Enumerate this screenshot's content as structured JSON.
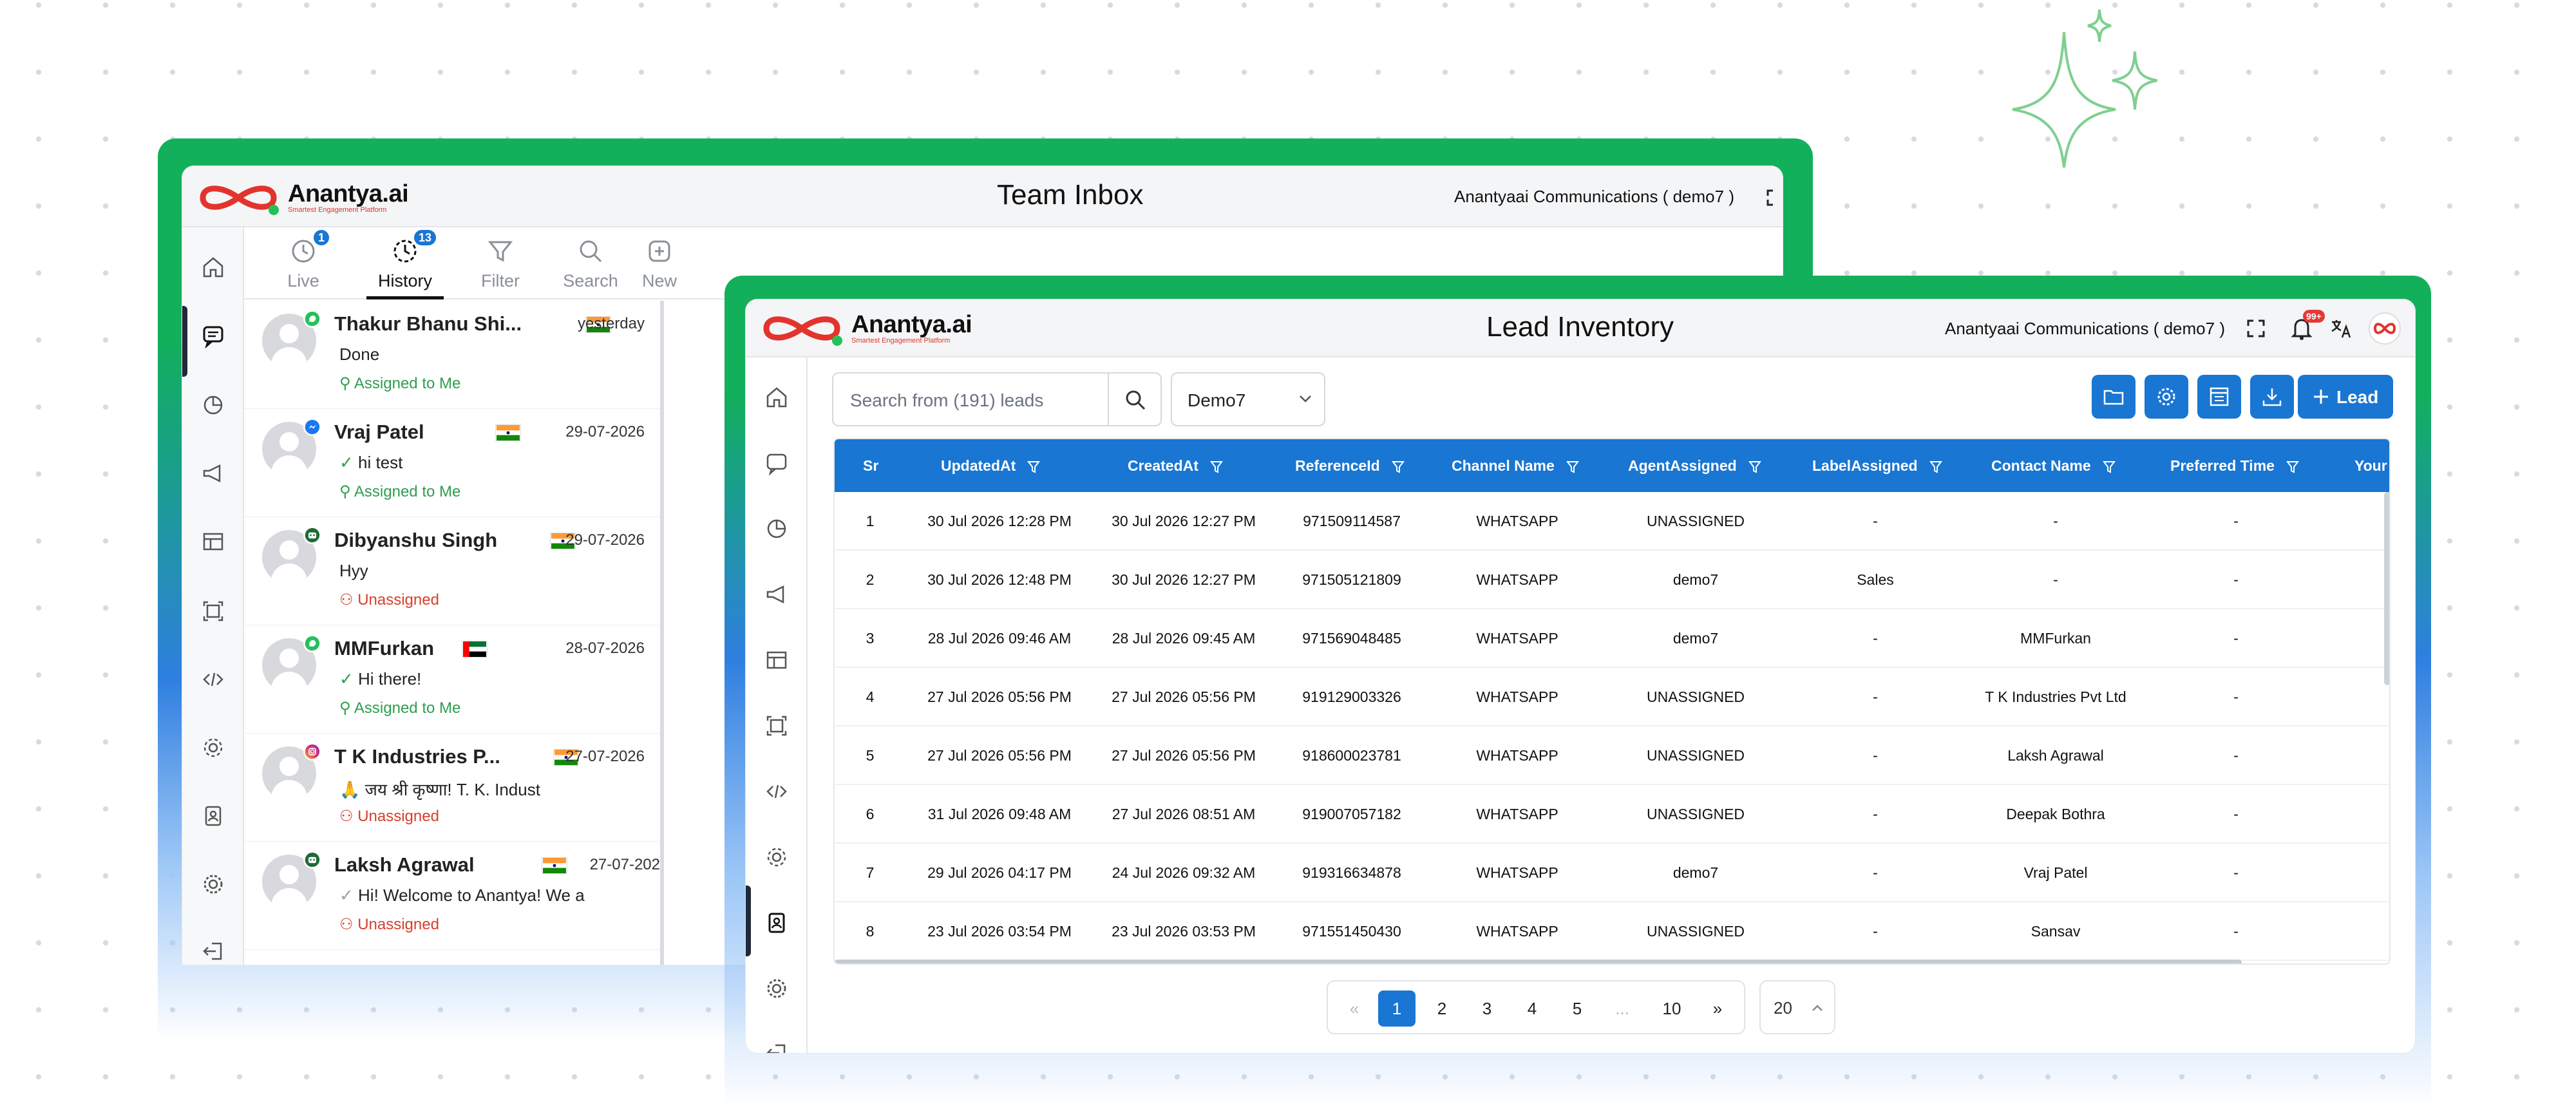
{
  "brand": {
    "name": "Anantya.ai",
    "tagline": "Smartest Engagement Platform"
  },
  "inbox": {
    "title": "Team Inbox",
    "company": "Anantyaai Communications ( demo7 )",
    "tabs": [
      {
        "label": "Live",
        "badge": "1",
        "icon": "clock-icon"
      },
      {
        "label": "History",
        "badge": "13",
        "icon": "history-icon"
      },
      {
        "label": "Filter",
        "icon": "filter-icon"
      },
      {
        "label": "Search",
        "icon": "search-icon"
      },
      {
        "label": "New",
        "icon": "new-chat-icon"
      }
    ],
    "chats": [
      {
        "name": "Thakur Bhanu Shi...",
        "date": "yesterday",
        "message": "Done",
        "status": "Assigned to Me",
        "assigned": true,
        "channel": "whatsapp",
        "flag": "india"
      },
      {
        "name": "Vraj Patel",
        "date": "29-07-2026",
        "message": "hi test",
        "status": "Assigned to Me",
        "assigned": true,
        "channel": "messenger",
        "flag": "india"
      },
      {
        "name": "Dibyanshu Singh",
        "date": "29-07-2026",
        "message": "Hyy",
        "status": "Unassigned",
        "assigned": false,
        "channel": "bot",
        "flag": "india"
      },
      {
        "name": "MMFurkan",
        "date": "28-07-2026",
        "message": "Hi there!",
        "status": "Assigned to Me",
        "assigned": true,
        "channel": "whatsapp",
        "flag": "uae"
      },
      {
        "name": "T K Industries P...",
        "date": "27-07-2026",
        "message": "🙏 जय श्री कृष्णा! T. K. Indust",
        "status": "Unassigned",
        "assigned": false,
        "channel": "instagram",
        "flag": "india"
      },
      {
        "name": "Laksh Agrawal",
        "date": "27-07-202",
        "message": "Hi! Welcome to Anantya! We a",
        "status": "Unassigned",
        "assigned": false,
        "channel": "bot",
        "flag": "india"
      }
    ]
  },
  "leads": {
    "title": "Lead Inventory",
    "company": "Anantyaai Communications ( demo7 )",
    "notification_count": "99+",
    "search_placeholder": "Search from (191) leads",
    "filter_value": "Demo7",
    "add_label": "Lead",
    "columns": [
      "Sr",
      "UpdatedAt",
      "CreatedAt",
      "ReferenceId",
      "Channel Name",
      "AgentAssigned",
      "LabelAssigned",
      "Contact Name",
      "Preferred Time",
      "Your N"
    ],
    "rows": [
      [
        "1",
        "30 Jul 2026 12:28 PM",
        "30 Jul 2026 12:27 PM",
        "971509114587",
        "WHATSAPP",
        "UNASSIGNED",
        "-",
        "-",
        "-"
      ],
      [
        "2",
        "30 Jul 2026 12:48 PM",
        "30 Jul 2026 12:27 PM",
        "971505121809",
        "WHATSAPP",
        "demo7",
        "Sales",
        "-",
        "-"
      ],
      [
        "3",
        "28 Jul 2026 09:46 AM",
        "28 Jul 2026 09:45 AM",
        "971569048485",
        "WHATSAPP",
        "demo7",
        "-",
        "MMFurkan",
        "-"
      ],
      [
        "4",
        "27 Jul 2026 05:56 PM",
        "27 Jul 2026 05:56 PM",
        "919129003326",
        "WHATSAPP",
        "UNASSIGNED",
        "-",
        "T K Industries Pvt Ltd",
        "-"
      ],
      [
        "5",
        "27 Jul 2026 05:56 PM",
        "27 Jul 2026 05:56 PM",
        "918600023781",
        "WHATSAPP",
        "UNASSIGNED",
        "-",
        "Laksh Agrawal",
        "-"
      ],
      [
        "6",
        "31 Jul 2026 09:48 AM",
        "27 Jul 2026 08:51 AM",
        "919007057182",
        "WHATSAPP",
        "UNASSIGNED",
        "-",
        "Deepak Bothra",
        "-"
      ],
      [
        "7",
        "29 Jul 2026 04:17 PM",
        "24 Jul 2026 09:32 AM",
        "919316634878",
        "WHATSAPP",
        "demo7",
        "-",
        "Vraj Patel",
        "-"
      ],
      [
        "8",
        "23 Jul 2026 03:54 PM",
        "23 Jul 2026 03:53 PM",
        "971551450430",
        "WHATSAPP",
        "UNASSIGNED",
        "-",
        "Sansav",
        "-"
      ]
    ],
    "pagination": {
      "prev": "«",
      "pages": [
        "1",
        "2",
        "3",
        "4",
        "5",
        "...",
        "10"
      ],
      "next": "»",
      "current": "1",
      "page_size": "20"
    }
  },
  "colors": {
    "primary": "#1976d2",
    "frame_green": "#12b05b",
    "assigned": "#2e9e4f",
    "unassigned": "#d6402b"
  }
}
